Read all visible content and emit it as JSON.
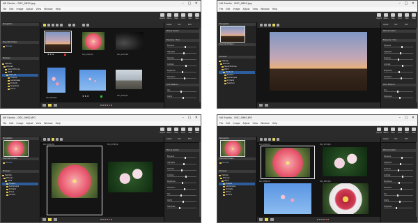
{
  "title": "NX Studio - DSC_0850.jpg",
  "titles": [
    "NX Studio - DSC_0850.jpg",
    "NX Studio - DSC_0850.jpg",
    "NX Studio - DSC_0962.JPG",
    "NX Studio - DSC_0962.JPG"
  ],
  "menu": [
    "File",
    "Edit",
    "Image",
    "Adjust",
    "View",
    "Window",
    "Help"
  ],
  "ribbon": [
    "Import",
    "Nikon",
    "Map",
    "Print",
    "Mail",
    "Web"
  ],
  "left": {
    "navigation": "Navigation",
    "favorites_header": "Favorite Folders",
    "fav_item": "Pictures",
    "folders_header": "Browser",
    "tree": [
      "Desktop",
      "Pictures",
      "Saved Pictures",
      "2023",
      "2023_04",
      "Flowers",
      "Landscapes",
      "Portraits",
      "Snapshots",
      "Drone",
      "Selected",
      "Archive"
    ]
  },
  "right": {
    "tabs": [
      "Adjust",
      "Info",
      "Edit"
    ],
    "section1": "Picture Control",
    "section2": "Exposure / Tone",
    "section3": "Color Balance",
    "sliders": [
      "Exposure",
      "Highlights",
      "Shadows",
      "Contrast",
      "Brightness",
      "Saturation",
      "Hue",
      "Clarity",
      "Sharpness"
    ]
  },
  "center": {
    "captions": [
      "DSC_0850.jpg",
      "DSC_0962.JPG",
      "DSC_0921.NEF",
      "DSC_0874.JPG",
      "DSC_0889.JPG",
      "DSC_0902.JPG",
      "DSC_0962.JPG",
      "DSC_0978.JPG"
    ],
    "stars": "★★★"
  },
  "accent": "#e8d85a"
}
